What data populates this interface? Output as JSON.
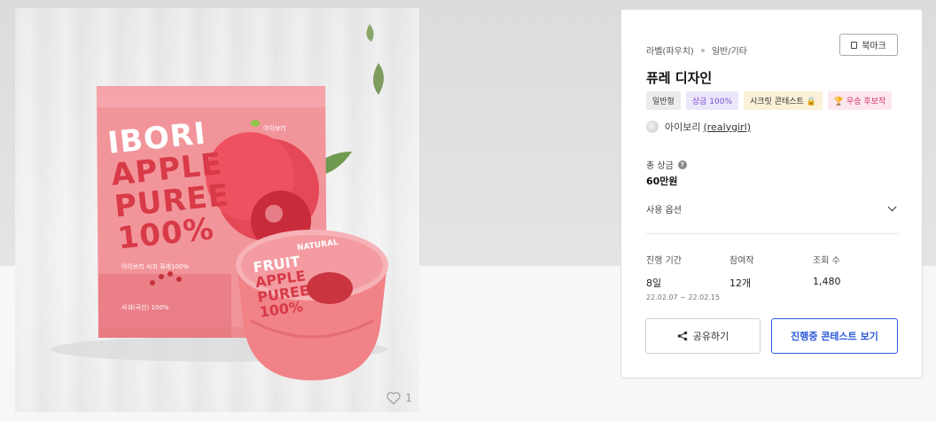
{
  "product_image": {
    "pouch_text": [
      "IBORI",
      "APPLE",
      "PUREE",
      "100%"
    ],
    "pouch_brand": "아이보리",
    "pouch_small": "아이보리 사과 퓨레100%",
    "pouch_bottom": "사과(국산) 100%",
    "cup_text": [
      "FRUIT",
      "APPLE",
      "PUREE",
      "100%"
    ],
    "cup_top": "NATURAL",
    "like_count": "1"
  },
  "info": {
    "category": "라벨(파우치)",
    "subcategory": "일반/기타",
    "bookmark_label": "북마크",
    "title": "퓨레 디자인",
    "tags": [
      "일반형",
      "상금 100%",
      "시크릿 콘테스트 🔒",
      "🏆 우승 후보작"
    ],
    "author_name": "아이보리",
    "author_handle": "(realygirl)",
    "prize_label": "총 상금",
    "prize_value": "60만원",
    "usage_label": "사용 옵션",
    "stats": {
      "period_label": "진행 기간",
      "period_value": "8일",
      "period_range": "22.02.07 ~ 22.02.15",
      "entries_label": "참여작",
      "entries_value": "12개",
      "views_label": "조회 수",
      "views_value": "1,480"
    },
    "share_label": "공유하기",
    "view_label": "진행중 콘테스트 보기"
  },
  "colors": {
    "accent": "#2d5ad9",
    "pouch": "#f08a8f",
    "pouch_text": "#d83a48"
  }
}
